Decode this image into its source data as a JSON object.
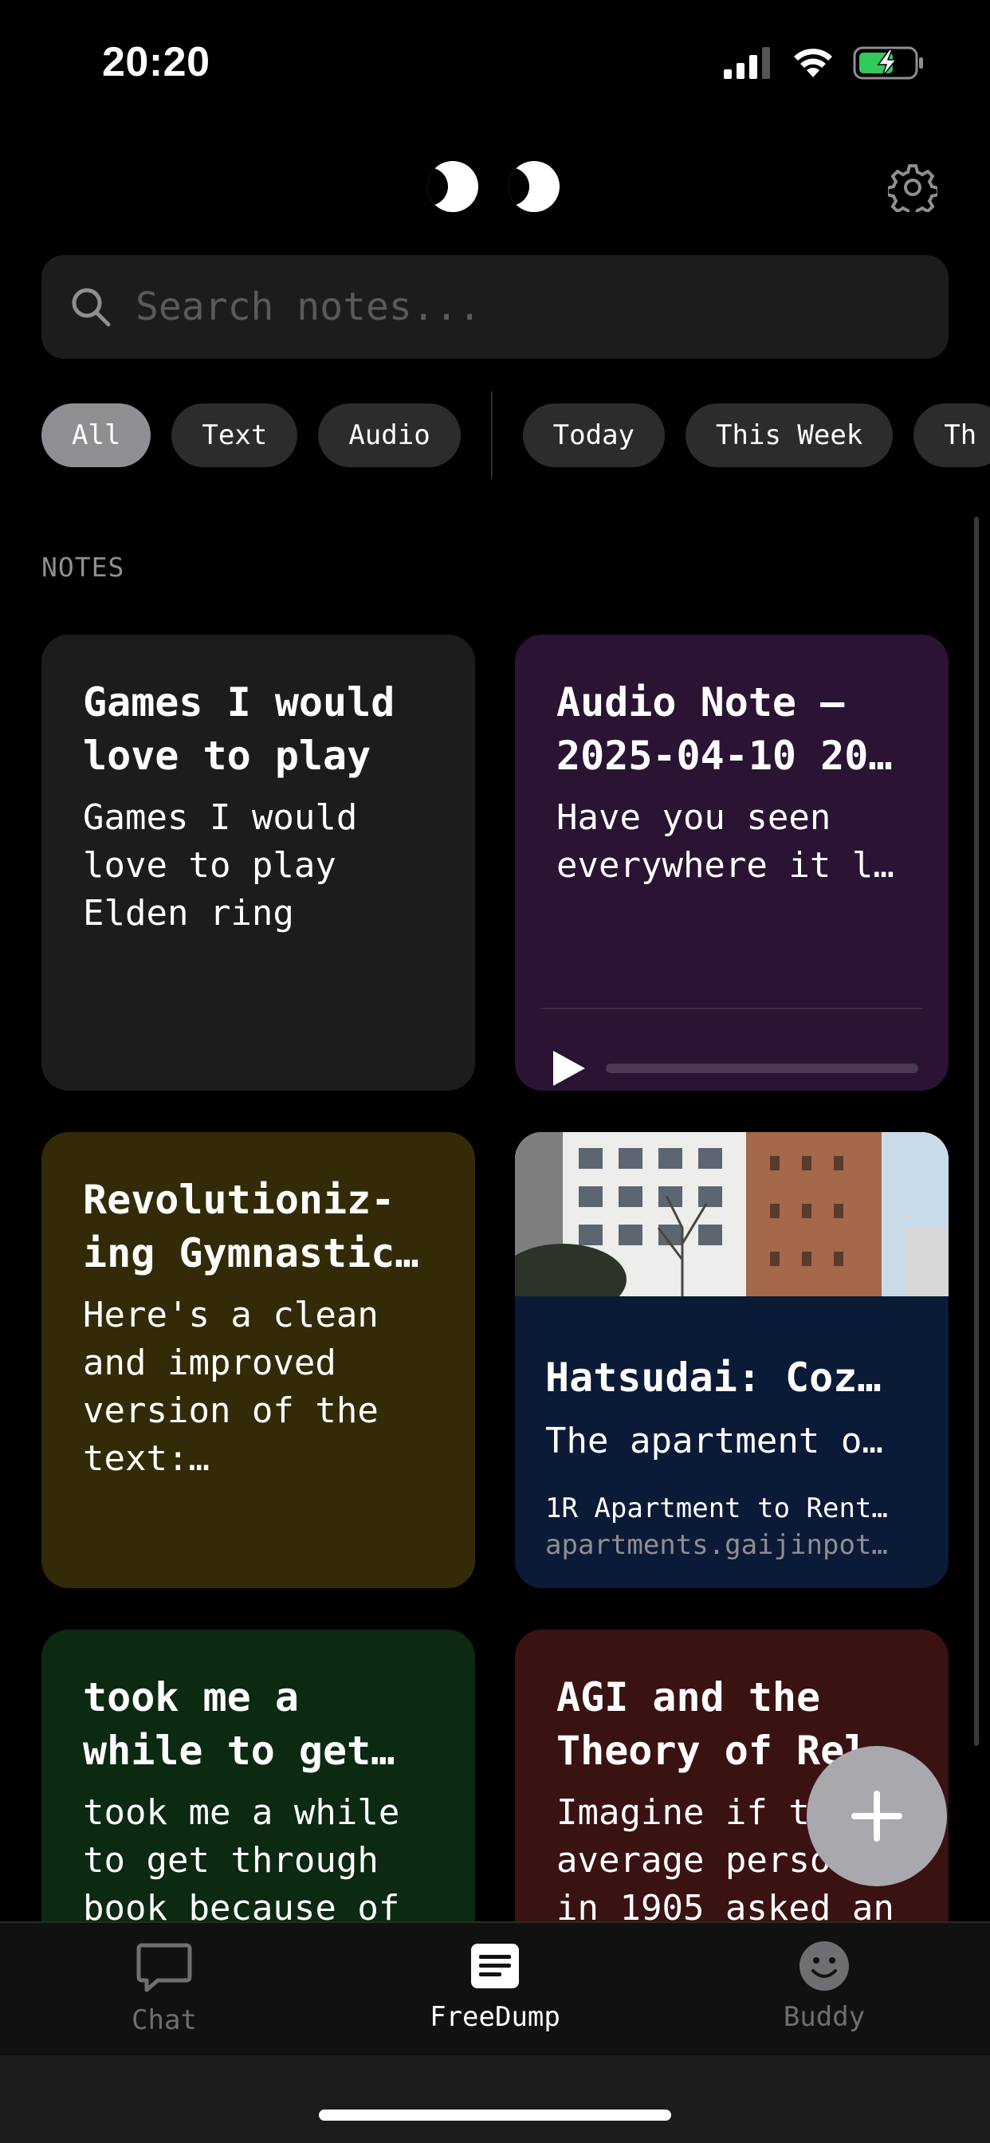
{
  "status_bar": {
    "time": "20:20"
  },
  "search": {
    "placeholder": "Search notes..."
  },
  "filters": {
    "types": [
      "All",
      "Text",
      "Audio"
    ],
    "dates": [
      "Today",
      "This Week",
      "Th"
    ]
  },
  "section_label": "NOTES",
  "notes": {
    "games": {
      "title": "Games I would\nlove to play",
      "body": "Games I would\nlove to play\nElden ring"
    },
    "audio": {
      "title": "Audio Note –\n2025-04-10 20…",
      "body": "Have you seen\neverywhere it l…"
    },
    "gym": {
      "title": "Revolutioniz-\ning Gymnastic…",
      "body": "Here's a clean\nand improved\nversion of the\ntext:…"
    },
    "hatsudai": {
      "title": "Hatsudai: Coz…",
      "body": "The apartment o…",
      "link_title": "1R Apartment to Rent…",
      "link_url": "apartments.gaijinpot…"
    },
    "took": {
      "title": "took me a\nwhile to get…",
      "body": "took me a while\nto get through\nbook because of"
    },
    "agi": {
      "title": "AGI and the\nTheory of Rel",
      "body": "Imagine if t\naverage perso\nin 1905 asked an"
    }
  },
  "tabs": {
    "chat": "Chat",
    "freedump": "FreeDump",
    "buddy": "Buddy"
  },
  "colors": {
    "card_text": "#1c1c1e",
    "card_audio": "#2a1333",
    "card_yellow": "#332b08",
    "card_link": "#0b1a36",
    "card_green": "#0c2912",
    "card_red": "#3a1211",
    "battery": "#34c759"
  }
}
